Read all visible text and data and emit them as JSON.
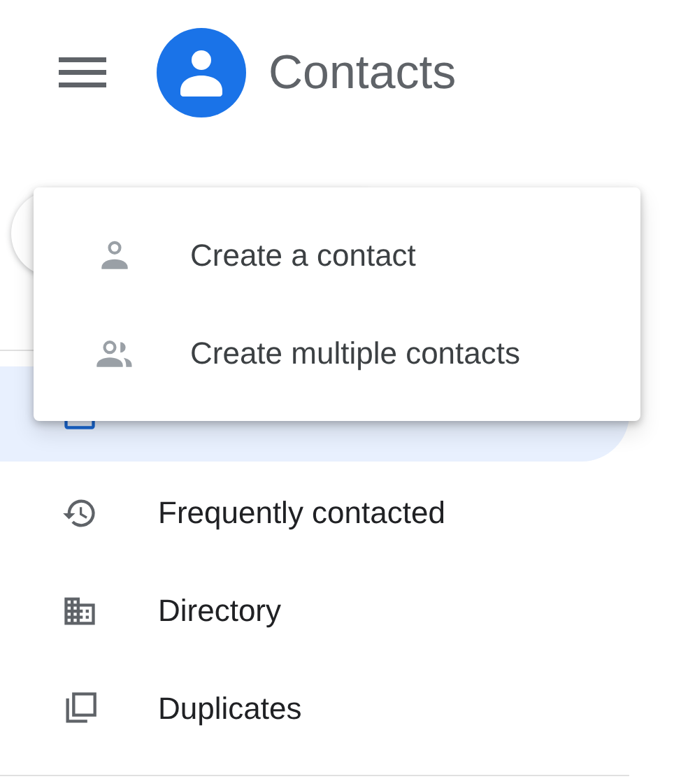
{
  "header": {
    "title": "Contacts"
  },
  "nav": [
    {
      "selected": true
    },
    {
      "label": "Frequently contacted",
      "selected": false
    },
    {
      "label": "Directory",
      "selected": false
    },
    {
      "label": "Duplicates",
      "selected": false
    }
  ],
  "menu": [
    {
      "label": "Create a contact"
    },
    {
      "label": "Create multiple contacts"
    }
  ]
}
